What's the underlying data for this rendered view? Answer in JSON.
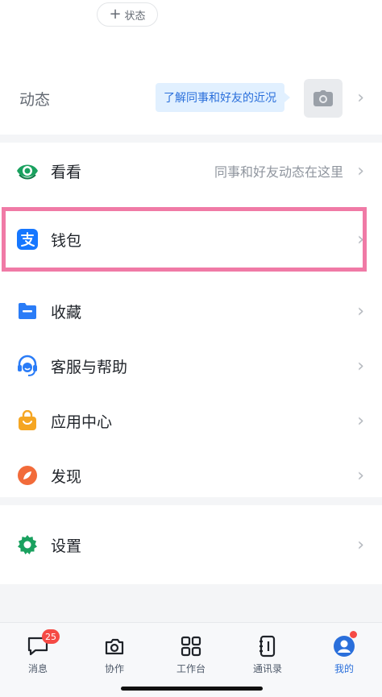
{
  "top": {
    "status_label": "状态"
  },
  "dynamic": {
    "label": "动态",
    "bubble": "了解同事和好友的近况"
  },
  "menu": {
    "kankan": {
      "label": "看看",
      "hint": "同事和好友动态在这里",
      "icon": "eye-icon",
      "color": "#1aa15f"
    },
    "wallet": {
      "label": "钱包",
      "icon": "alipay-icon",
      "color": "#1677ff"
    },
    "favorites": {
      "label": "收藏",
      "icon": "folder-icon",
      "color": "#2a7cf7"
    },
    "help": {
      "label": "客服与帮助",
      "icon": "customer-service-icon",
      "color": "#2a7cf7"
    },
    "apps": {
      "label": "应用中心",
      "icon": "shopping-bag-icon",
      "color": "#f5a623"
    },
    "discover": {
      "label": "发现",
      "icon": "compass-icon",
      "color": "#f26b3a"
    },
    "settings": {
      "label": "设置",
      "icon": "gear-icon",
      "color": "#1aa15f"
    }
  },
  "tabbar": {
    "items": [
      {
        "label": "消息",
        "icon": "chat-icon",
        "badge": "25"
      },
      {
        "label": "协作",
        "icon": "collab-icon"
      },
      {
        "label": "工作台",
        "icon": "grid-icon"
      },
      {
        "label": "通讯录",
        "icon": "contacts-icon"
      },
      {
        "label": "我的",
        "icon": "me-icon",
        "active": true
      }
    ]
  }
}
